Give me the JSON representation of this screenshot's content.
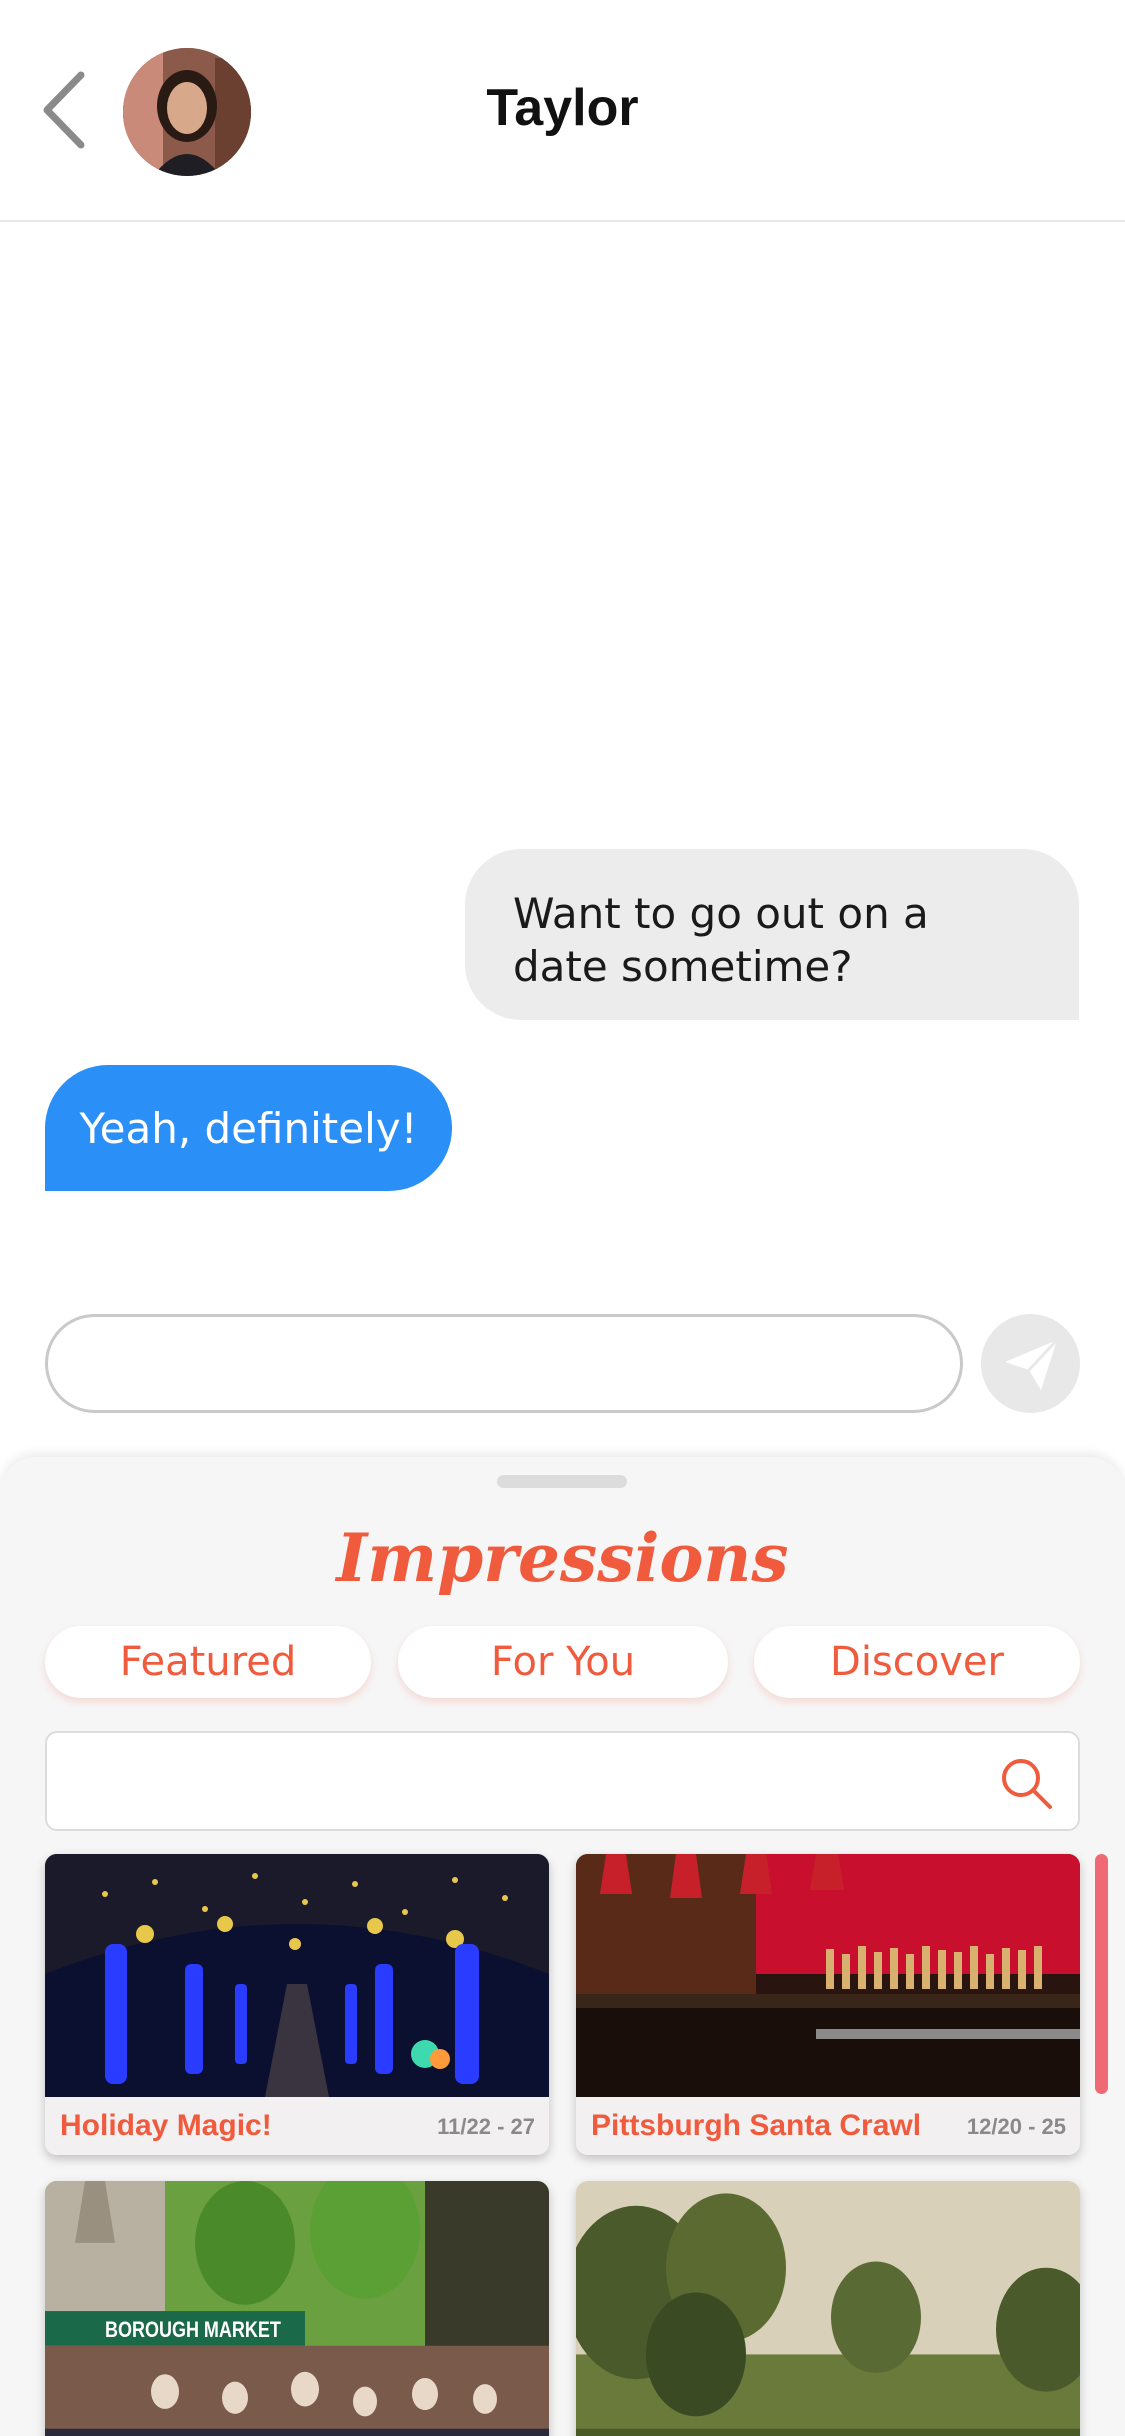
{
  "header": {
    "contact_name": "Taylor"
  },
  "messages": [
    {
      "from": "me",
      "text": "Want to go out on a date sometime?"
    },
    {
      "from": "them",
      "text": "Yeah, definitely!"
    }
  ],
  "composer": {
    "input_value": "",
    "input_placeholder": ""
  },
  "sheet": {
    "brand": "Impressions",
    "tabs": [
      {
        "label": "Featured"
      },
      {
        "label": "For You"
      },
      {
        "label": "Discover"
      }
    ],
    "search": {
      "value": "",
      "placeholder": ""
    },
    "cards": [
      {
        "title": "Holiday Magic!",
        "date": "11/22 - 27"
      },
      {
        "title": "Pittsburgh Santa Crawl",
        "date": "12/20 - 25"
      },
      {
        "title": "",
        "date": "",
        "sign_text": "BOROUGH MARKET"
      },
      {
        "title": "",
        "date": ""
      }
    ]
  },
  "colors": {
    "accent": "#f05a3d",
    "sent_bubble": "#ececec",
    "received_bubble": "#2a8ff7",
    "scroll_indicator": "#f06a76"
  },
  "icons": {
    "back": "chevron-left-icon",
    "send": "paper-plane-icon",
    "search": "search-icon"
  }
}
